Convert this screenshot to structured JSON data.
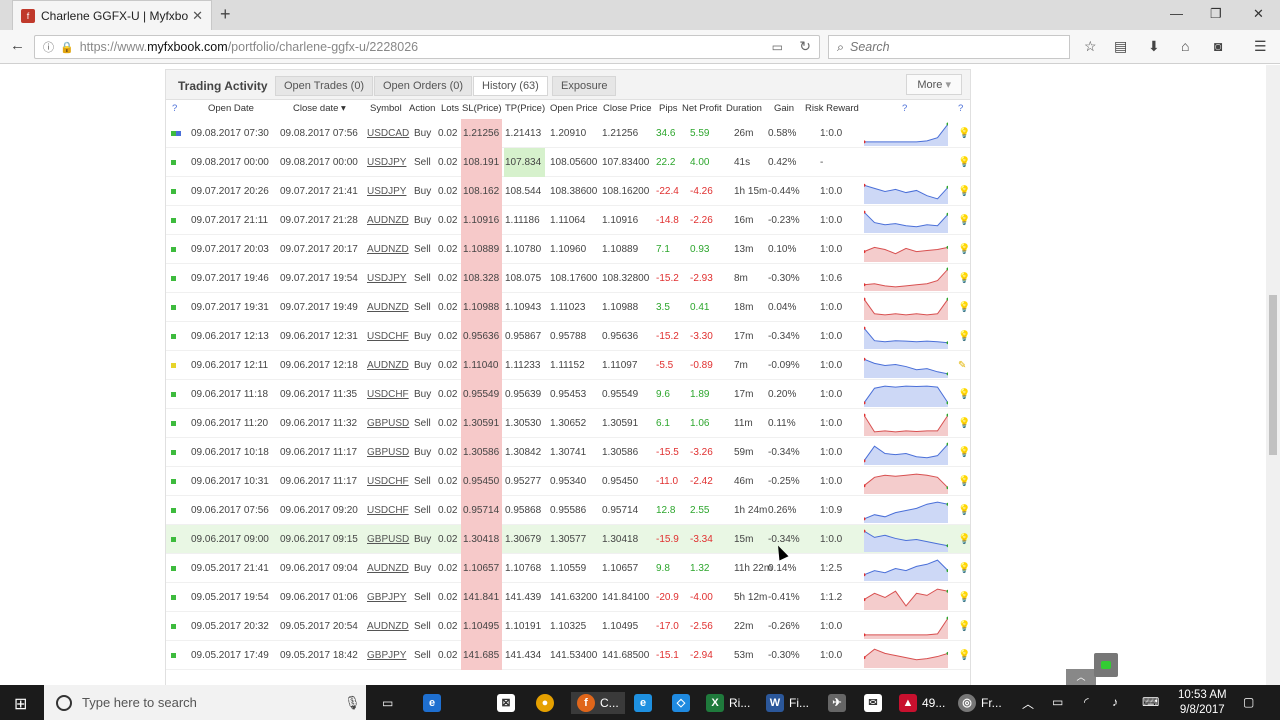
{
  "browser": {
    "tab_title": "Charlene GGFX-U | Myfxboo",
    "url": "https://www.myfxbook.com/portfolio/charlene-ggfx-u/2228026",
    "url_prefix": "https://www.",
    "url_host": "myfxbook.com",
    "url_path": "/portfolio/charlene-ggfx-u/2228026",
    "search_placeholder": "Search"
  },
  "panel": {
    "title": "Trading Activity",
    "tabs": [
      {
        "label": "Open Trades (0)"
      },
      {
        "label": "Open Orders (0)"
      },
      {
        "label": "History (63)"
      },
      {
        "label": "Exposure"
      }
    ],
    "more_label": "More",
    "columns": [
      "Open Date",
      "Close date",
      "Symbol",
      "Action",
      "Lots",
      "SL(Price)",
      "TP(Price)",
      "Open Price",
      "Close Price",
      "Pips",
      "Net Profit",
      "Duration",
      "Gain",
      "Risk Reward"
    ]
  },
  "trades": [
    {
      "open": "09.08.2017 07:30",
      "close": "09.08.2017 07:56",
      "symbol": "USDCAD",
      "action": "Buy",
      "lots": "0.02",
      "sl": "1.21256",
      "tp": "1.21413",
      "op": "1.20910",
      "cp": "1.21256",
      "pips": "34.6",
      "profit": "5.59",
      "dur": "26m",
      "gain": "0.58%",
      "rr": "1:0.0",
      "dot": "multi",
      "spark": [
        0.9,
        0.9,
        0.9,
        0.9,
        0.9,
        0.9,
        0.85,
        0.7,
        0.05
      ],
      "spark_color": "#4a6fd8"
    },
    {
      "open": "09.08.2017 00:00",
      "close": "09.08.2017 00:00",
      "symbol": "USDJPY",
      "action": "Sell",
      "lots": "0.02",
      "sl": "108.191",
      "tp": "107.834",
      "op": "108.05600",
      "cp": "107.83400",
      "pips": "22.2",
      "profit": "4.00",
      "dur": "41s",
      "gain": "0.42%",
      "rr": "-",
      "dot": "green",
      "spark": [],
      "spark_color": "#4a6fd8"
    },
    {
      "open": "09.07.2017 20:26",
      "close": "09.07.2017 21:41",
      "symbol": "USDJPY",
      "action": "Buy",
      "lots": "0.02",
      "sl": "108.162",
      "tp": "108.544",
      "op": "108.38600",
      "cp": "108.16200",
      "pips": "-22.4",
      "profit": "-4.26",
      "dur": "1h 15m",
      "gain": "-0.44%",
      "rr": "1:0.0",
      "dot": "green",
      "spark": [
        0.2,
        0.35,
        0.5,
        0.4,
        0.55,
        0.45,
        0.7,
        0.85,
        0.3
      ],
      "spark_color": "#4a6fd8"
    },
    {
      "open": "09.07.2017 21:11",
      "close": "09.07.2017 21:28",
      "symbol": "AUDNZD",
      "action": "Buy",
      "lots": "0.02",
      "sl": "1.10916",
      "tp": "1.11186",
      "op": "1.11064",
      "cp": "1.10916",
      "pips": "-14.8",
      "profit": "-2.26",
      "dur": "16m",
      "gain": "-0.23%",
      "rr": "1:0.0",
      "dot": "green",
      "spark": [
        0.1,
        0.6,
        0.7,
        0.65,
        0.75,
        0.8,
        0.7,
        0.75,
        0.2
      ],
      "spark_color": "#4a6fd8"
    },
    {
      "open": "09.07.2017 20:03",
      "close": "09.07.2017 20:17",
      "symbol": "AUDNZD",
      "action": "Sell",
      "lots": "0.02",
      "sl": "1.10889",
      "tp": "1.10780",
      "op": "1.10960",
      "cp": "1.10889",
      "pips": "7.1",
      "profit": "0.93",
      "dur": "13m",
      "gain": "0.10%",
      "rr": "1:0.0",
      "dot": "green",
      "spark": [
        0.6,
        0.4,
        0.5,
        0.7,
        0.45,
        0.6,
        0.55,
        0.5,
        0.4
      ],
      "spark_color": "#d85050"
    },
    {
      "open": "09.07.2017 19:46",
      "close": "09.07.2017 19:54",
      "symbol": "USDJPY",
      "action": "Sell",
      "lots": "0.02",
      "sl": "108.328",
      "tp": "108.075",
      "op": "108.17600",
      "cp": "108.32800",
      "pips": "-15.2",
      "profit": "-2.93",
      "dur": "8m",
      "gain": "-0.30%",
      "rr": "1:0.6",
      "dot": "green",
      "spark": [
        0.8,
        0.75,
        0.85,
        0.9,
        0.85,
        0.8,
        0.75,
        0.6,
        0.05
      ],
      "spark_color": "#d85050"
    },
    {
      "open": "09.07.2017 19:31",
      "close": "09.07.2017 19:49",
      "symbol": "AUDNZD",
      "action": "Sell",
      "lots": "0.02",
      "sl": "1.10988",
      "tp": "1.10943",
      "op": "1.11023",
      "cp": "1.10988",
      "pips": "3.5",
      "profit": "0.41",
      "dur": "18m",
      "gain": "0.04%",
      "rr": "1:0.0",
      "dot": "green",
      "spark": [
        0.1,
        0.8,
        0.85,
        0.8,
        0.85,
        0.8,
        0.85,
        0.8,
        0.1
      ],
      "spark_color": "#d85050"
    },
    {
      "open": "09.06.2017 12:13",
      "close": "09.06.2017 12:31",
      "symbol": "USDCHF",
      "action": "Buy",
      "lots": "0.02",
      "sl": "0.95636",
      "tp": "0.95867",
      "op": "0.95788",
      "cp": "0.95636",
      "pips": "-15.2",
      "profit": "-3.30",
      "dur": "17m",
      "gain": "-0.34%",
      "rr": "1:0.0",
      "dot": "green",
      "spark": [
        0.1,
        0.7,
        0.75,
        0.7,
        0.72,
        0.75,
        0.72,
        0.75,
        0.8
      ],
      "spark_color": "#4a6fd8"
    },
    {
      "open": "09.06.2017 12:11",
      "close": "09.06.2017 12:18",
      "symbol": "AUDNZD",
      "action": "Buy",
      "lots": "0.02",
      "sl": "1.11040",
      "tp": "1.11233",
      "op": "1.11152",
      "cp": "1.11097",
      "pips": "-5.5",
      "profit": "-0.89",
      "dur": "7m",
      "gain": "-0.09%",
      "rr": "1:0.0",
      "dot": "yellow",
      "spark": [
        0.2,
        0.4,
        0.5,
        0.45,
        0.55,
        0.7,
        0.65,
        0.8,
        0.9
      ],
      "spark_color": "#4a6fd8"
    },
    {
      "open": "09.06.2017 11:18",
      "close": "09.06.2017 11:35",
      "symbol": "USDCHF",
      "action": "Buy",
      "lots": "0.02",
      "sl": "0.95549",
      "tp": "0.95639",
      "op": "0.95453",
      "cp": "0.95549",
      "pips": "9.6",
      "profit": "1.89",
      "dur": "17m",
      "gain": "0.20%",
      "rr": "1:0.0",
      "dot": "green",
      "spark": [
        0.9,
        0.2,
        0.1,
        0.15,
        0.1,
        0.12,
        0.1,
        0.15,
        0.9
      ],
      "spark_color": "#4a6fd8"
    },
    {
      "open": "09.06.2017 11:20",
      "close": "09.06.2017 11:32",
      "symbol": "GBPUSD",
      "action": "Sell",
      "lots": "0.02",
      "sl": "1.30591",
      "tp": "1.30530",
      "op": "1.30652",
      "cp": "1.30591",
      "pips": "6.1",
      "profit": "1.06",
      "dur": "11m",
      "gain": "0.11%",
      "rr": "1:0.0",
      "dot": "green",
      "spark": [
        0.1,
        0.9,
        0.85,
        0.9,
        0.85,
        0.88,
        0.85,
        0.85,
        0.1
      ],
      "spark_color": "#d85050"
    },
    {
      "open": "09.06.2017 10:18",
      "close": "09.06.2017 11:17",
      "symbol": "GBPUSD",
      "action": "Buy",
      "lots": "0.02",
      "sl": "1.30586",
      "tp": "1.30842",
      "op": "1.30741",
      "cp": "1.30586",
      "pips": "-15.5",
      "profit": "-3.26",
      "dur": "59m",
      "gain": "-0.34%",
      "rr": "1:0.0",
      "dot": "green",
      "spark": [
        0.9,
        0.2,
        0.55,
        0.6,
        0.55,
        0.7,
        0.75,
        0.65,
        0.1
      ],
      "spark_color": "#4a6fd8"
    },
    {
      "open": "09.06.2017 10:31",
      "close": "09.06.2017 11:17",
      "symbol": "USDCHF",
      "action": "Sell",
      "lots": "0.02",
      "sl": "0.95450",
      "tp": "0.95277",
      "op": "0.95340",
      "cp": "0.95450",
      "pips": "-11.0",
      "profit": "-2.42",
      "dur": "46m",
      "gain": "-0.25%",
      "rr": "1:0.0",
      "dot": "green",
      "spark": [
        0.7,
        0.3,
        0.2,
        0.25,
        0.2,
        0.15,
        0.2,
        0.3,
        0.8
      ],
      "spark_color": "#d85050"
    },
    {
      "open": "09.06.2017 07:56",
      "close": "09.06.2017 09:20",
      "symbol": "USDCHF",
      "action": "Sell",
      "lots": "0.02",
      "sl": "0.95714",
      "tp": "0.95868",
      "op": "0.95586",
      "cp": "0.95714",
      "pips": "12.8",
      "profit": "2.55",
      "dur": "1h 24m",
      "gain": "0.26%",
      "rr": "1:0.9",
      "dot": "green",
      "spark": [
        0.9,
        0.7,
        0.8,
        0.6,
        0.5,
        0.4,
        0.2,
        0.1,
        0.2
      ],
      "spark_color": "#4a6fd8"
    },
    {
      "open": "09.06.2017 09:00",
      "close": "09.06.2017 09:15",
      "symbol": "GBPUSD",
      "action": "Buy",
      "lots": "0.02",
      "sl": "1.30418",
      "tp": "1.30679",
      "op": "1.30577",
      "cp": "1.30418",
      "pips": "-15.9",
      "profit": "-3.34",
      "dur": "15m",
      "gain": "-0.34%",
      "rr": "1:0.0",
      "dot": "green",
      "highlight": true,
      "spark": [
        0.1,
        0.4,
        0.3,
        0.45,
        0.55,
        0.5,
        0.6,
        0.7,
        0.8
      ],
      "spark_color": "#4a6fd8"
    },
    {
      "open": "09.05.2017 21:41",
      "close": "09.06.2017 09:04",
      "symbol": "AUDNZD",
      "action": "Buy",
      "lots": "0.02",
      "sl": "1.10657",
      "tp": "1.10768",
      "op": "1.10559",
      "cp": "1.10657",
      "pips": "9.8",
      "profit": "1.32",
      "dur": "11h 22m",
      "gain": "0.14%",
      "rr": "1:2.5",
      "dot": "green",
      "spark": [
        0.8,
        0.6,
        0.7,
        0.5,
        0.6,
        0.4,
        0.3,
        0.1,
        0.6
      ],
      "spark_color": "#4a6fd8"
    },
    {
      "open": "09.05.2017 19:54",
      "close": "09.06.2017 01:06",
      "symbol": "GBPJPY",
      "action": "Sell",
      "lots": "0.02",
      "sl": "141.841",
      "tp": "141.439",
      "op": "141.63200",
      "cp": "141.84100",
      "pips": "-20.9",
      "profit": "-4.00",
      "dur": "5h 12m",
      "gain": "-0.41%",
      "rr": "1:1.2",
      "dot": "green",
      "spark": [
        0.6,
        0.3,
        0.5,
        0.2,
        0.9,
        0.3,
        0.4,
        0.1,
        0.2
      ],
      "spark_color": "#d85050"
    },
    {
      "open": "09.05.2017 20:32",
      "close": "09.05.2017 20:54",
      "symbol": "AUDNZD",
      "action": "Sell",
      "lots": "0.02",
      "sl": "1.10495",
      "tp": "1.10191",
      "op": "1.10325",
      "cp": "1.10495",
      "pips": "-17.0",
      "profit": "-2.56",
      "dur": "22m",
      "gain": "-0.26%",
      "rr": "1:0.0",
      "dot": "green",
      "spark": [
        0.9,
        0.9,
        0.9,
        0.9,
        0.9,
        0.9,
        0.9,
        0.85,
        0.1
      ],
      "spark_color": "#d85050"
    },
    {
      "open": "09.05.2017 17:49",
      "close": "09.05.2017 18:42",
      "symbol": "GBPJPY",
      "action": "Sell",
      "lots": "0.02",
      "sl": "141.685",
      "tp": "141.434",
      "op": "141.53400",
      "cp": "141.68500",
      "pips": "-15.1",
      "profit": "-2.94",
      "dur": "53m",
      "gain": "-0.30%",
      "rr": "1:0.0",
      "dot": "green",
      "spark": [
        0.6,
        0.2,
        0.4,
        0.5,
        0.6,
        0.7,
        0.65,
        0.55,
        0.4
      ],
      "spark_color": "#d85050"
    }
  ],
  "taskbar": {
    "search_placeholder": "Type here to search",
    "apps": [
      {
        "label": "C..."
      },
      {
        "label": "Ri..."
      },
      {
        "label": "Fi..."
      },
      {
        "label": "49..."
      },
      {
        "label": "Fr..."
      }
    ],
    "time": "10:53 AM",
    "date": "9/8/2017"
  }
}
